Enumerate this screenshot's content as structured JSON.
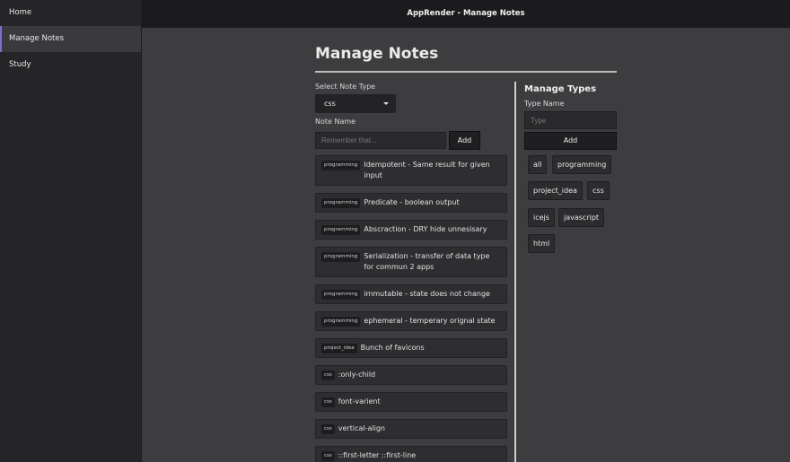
{
  "sidebar": {
    "items": [
      {
        "label": "Home"
      },
      {
        "label": "Manage Notes"
      },
      {
        "label": "Study"
      }
    ]
  },
  "topbar": {
    "title": "AppRender - Manage Notes"
  },
  "page": {
    "title": "Manage Notes"
  },
  "form": {
    "note_type_label": "Select Note Type",
    "note_type_value": "css",
    "note_name_label": "Note Name",
    "note_name_placeholder": "Remember that...",
    "add_label": "Add"
  },
  "notes": [
    {
      "tag": "programming",
      "text": "Idempotent - Same result for given input"
    },
    {
      "tag": "programming",
      "text": "Predicate - boolean output"
    },
    {
      "tag": "programming",
      "text": "Abscraction - DRY hide unnesisary"
    },
    {
      "tag": "programming",
      "text": "Serialization - transfer of data type for commun 2 apps"
    },
    {
      "tag": "programming",
      "text": "immutable - state does not change"
    },
    {
      "tag": "programming",
      "text": "ephemeral - temperary orignal state"
    },
    {
      "tag": "project_idea",
      "text": "Bunch of favicons"
    },
    {
      "tag": "css",
      "text": ":only-child"
    },
    {
      "tag": "css",
      "text": "font-varient"
    },
    {
      "tag": "css",
      "text": "vertical-align"
    },
    {
      "tag": "css",
      "text": "::first-letter ::first-line"
    }
  ],
  "manage_types": {
    "title": "Manage Types",
    "type_name_label": "Type Name",
    "type_name_placeholder": "Type",
    "add_label": "Add",
    "types": [
      "all",
      "programming",
      "project_idea",
      "css",
      "icejs",
      "javascript",
      "html"
    ]
  }
}
